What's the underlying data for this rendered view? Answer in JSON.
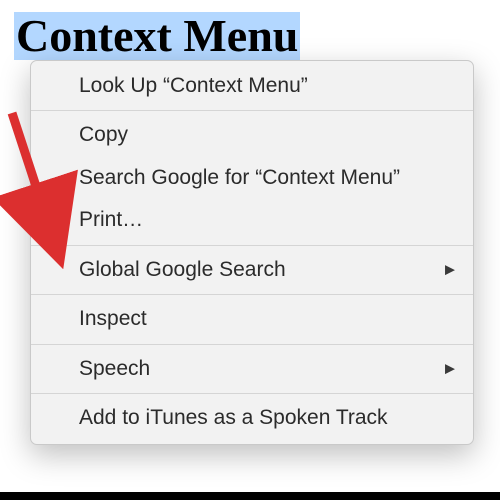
{
  "selected_text": "Context Menu",
  "menu": {
    "look_up": "Look Up “Context Menu”",
    "copy": "Copy",
    "search_google": "Search Google for “Context Menu”",
    "print": "Print…",
    "global_google_search": "Global Google Search",
    "inspect": "Inspect",
    "speech": "Speech",
    "add_to_itunes": "Add to iTunes as a Spoken Track"
  },
  "arrow_color": "#dc2f2f"
}
